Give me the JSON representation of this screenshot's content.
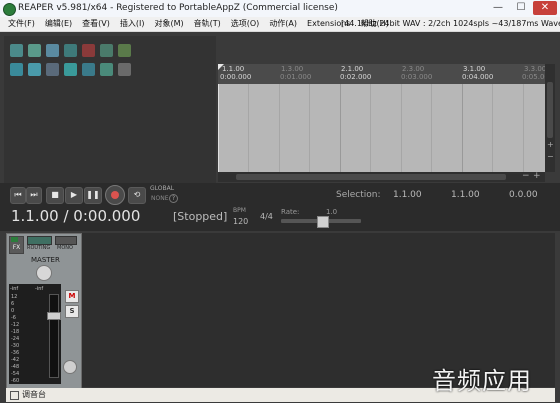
{
  "window": {
    "title": "REAPER v5.981/x64 - Registered to PortableAppZ (Commercial license)",
    "minimize": "—",
    "maximize": "☐",
    "close": "✕"
  },
  "menu": {
    "items": [
      "文件(F)",
      "编辑(E)",
      "查看(V)",
      "插入(I)",
      "对象(M)",
      "音轨(T)",
      "选项(O)",
      "动作(A)",
      "Extensions",
      "帮助(H)"
    ],
    "status": "[44.1kHz 24bit WAV : 2/2ch 1024spls ~43/187ms WaveOut]"
  },
  "ruler": {
    "bars": [
      {
        "label": "1.1.00",
        "time": "0:00.000",
        "dim": false
      },
      {
        "label": "1.3.00",
        "time": "0:01.000",
        "dim": true
      },
      {
        "label": "2.1.00",
        "time": "0:02.000",
        "dim": false
      },
      {
        "label": "2.3.00",
        "time": "0:03.000",
        "dim": true
      },
      {
        "label": "3.1.00",
        "time": "0:04.000",
        "dim": false
      },
      {
        "label": "3.3.00",
        "time": "0:05.000",
        "dim": true
      }
    ]
  },
  "transport": {
    "global_label": "GLOBAL",
    "none_label": "NONE",
    "selection_label": "Selection:",
    "sel_start": "1.1.00",
    "sel_end": "1.1.00",
    "sel_len": "0.0.00",
    "position": "1.1.00 / 0:00.000",
    "state": "[Stopped]",
    "bpm_label": "BPM",
    "bpm": "120",
    "time_sig": "4/4",
    "rate_label": "Rate:",
    "rate": "1.0"
  },
  "master": {
    "fx": "FX",
    "routing": "ROUTING",
    "mono": "MONO",
    "label": "MASTER",
    "inf_left": "-inf",
    "inf_right": "-inf",
    "scale": [
      "12",
      "6",
      "0",
      "-6",
      "-12",
      "-18",
      "-24",
      "-30",
      "-36",
      "-42",
      "-48",
      "-54",
      "-60"
    ],
    "mute": "M",
    "solo": "S"
  },
  "dock": {
    "label": "调音台"
  },
  "watermark": "音频应用",
  "colors": {
    "accent_green": "#2c7d3c",
    "arrange_bg": "#b7b7b7",
    "record_red": "#d9534f"
  }
}
